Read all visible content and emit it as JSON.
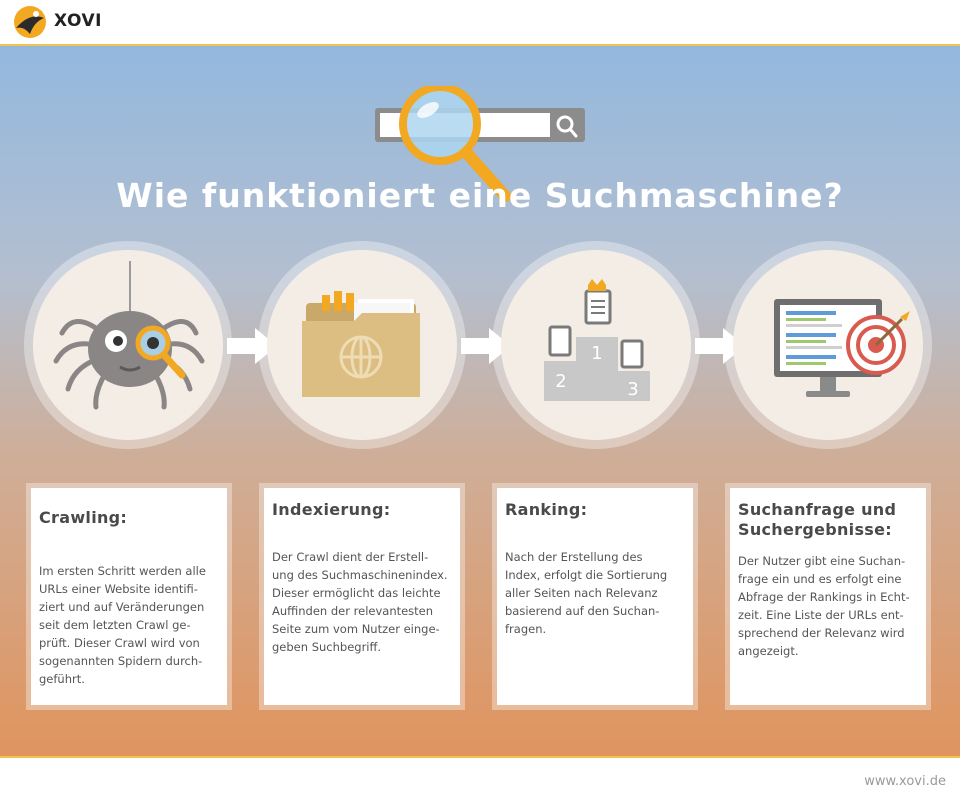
{
  "header": {
    "brand": "XOVI"
  },
  "hero": {
    "title": "Wie funktioniert eine Suchmaschine?"
  },
  "steps": [
    {
      "icon": "spider-icon",
      "title": "Crawling:",
      "body": "Im ersten Schritt werden alle\nURLs einer Website identifi-\nziert und auf Veränderungen\nseit dem letzten Crawl ge-\nprüft. Dieser Crawl wird von\nsogenannten Spidern durch-\ngeführt."
    },
    {
      "icon": "folder-icon",
      "title": "Indexierung:",
      "body": "Der Crawl dient der Erstell-\nung des Suchmaschinenindex.\nDieser ermöglicht das leichte\nAuffinden der relevantesten\nSeite zum vom Nutzer einge-\ngeben Suchbegriff."
    },
    {
      "icon": "podium-icon",
      "title": "Ranking:",
      "body": "Nach der Erstellung des\nIndex, erfolgt die Sortierung\naller Seiten nach Relevanz\nbasierend auf den Suchan-\nfragen."
    },
    {
      "icon": "monitor-target-icon",
      "title": "Suchanfrage und\nSuchergebnisse:",
      "body": "Der Nutzer gibt eine Suchan-\nfrage ein und es erfolgt eine\nAbfrage der Rankings in Echt-\nzeit. Eine Liste der URLs ent-\nsprechend der Relevanz wird\nangezeigt."
    }
  ],
  "podium_labels": [
    "1",
    "2",
    "3"
  ],
  "footer": {
    "url": "www.xovi.de"
  },
  "colors": {
    "accent": "#f2a820",
    "card_title": "#4a4a4a",
    "arrow": "#ffffff"
  }
}
